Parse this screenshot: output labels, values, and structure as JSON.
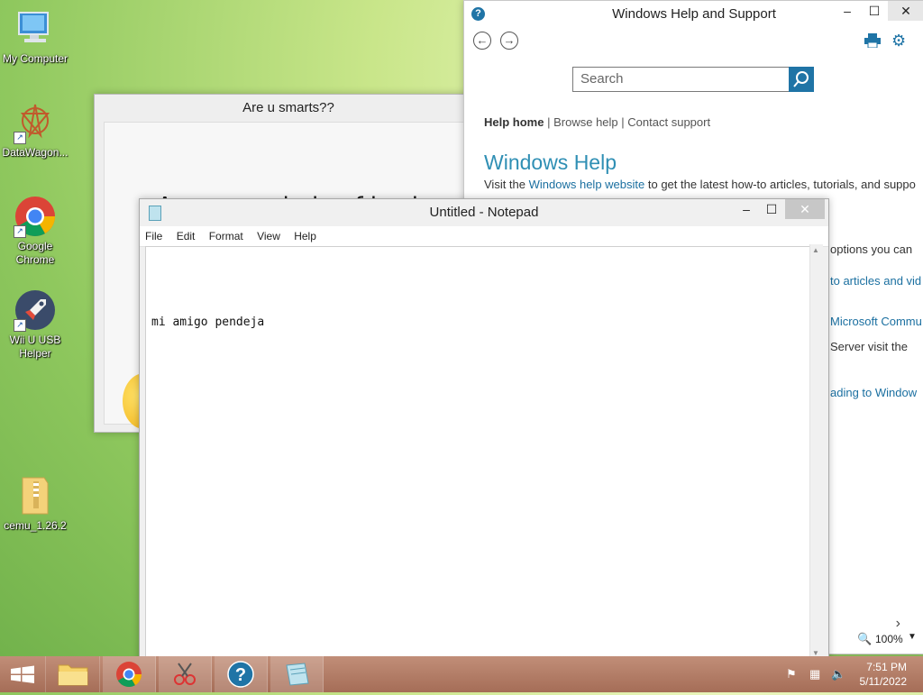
{
  "desktop": {
    "icons": [
      {
        "label": "My Computer"
      },
      {
        "label": "DataWagon..."
      },
      {
        "label": "Google Chrome"
      },
      {
        "label": "Wii U USB Helper"
      },
      {
        "label": "cemu_1.26.2"
      }
    ]
  },
  "quiz_window": {
    "title": "Are u smarts??",
    "question": "Are u capabale of basic mat"
  },
  "help_window": {
    "title": "Windows Help and Support",
    "search_placeholder": "Search",
    "links": {
      "home": "Help home",
      "browse": "Browse help",
      "contact": "Contact support",
      "sep": "|"
    },
    "heading": "Windows Help",
    "visit_prefix": "Visit the ",
    "visit_link": "Windows help website",
    "visit_suffix": " to get the latest how-to articles, tutorials, and suppo",
    "fragments": [
      "options you can",
      "to articles and vid",
      "Microsoft Commu",
      "Server visit the",
      "ading to Window"
    ],
    "zoom": "100%"
  },
  "notepad": {
    "title": "Untitled - Notepad",
    "menu": [
      "File",
      "Edit",
      "Format",
      "View",
      "Help"
    ],
    "content": "mi amigo pendeja"
  },
  "taskbar": {
    "time": "7:51 PM",
    "date": "5/11/2022"
  },
  "colors": {
    "accent": "#1f74a6",
    "help_heading": "#2f8fb4",
    "taskbar": "#b6806a"
  }
}
